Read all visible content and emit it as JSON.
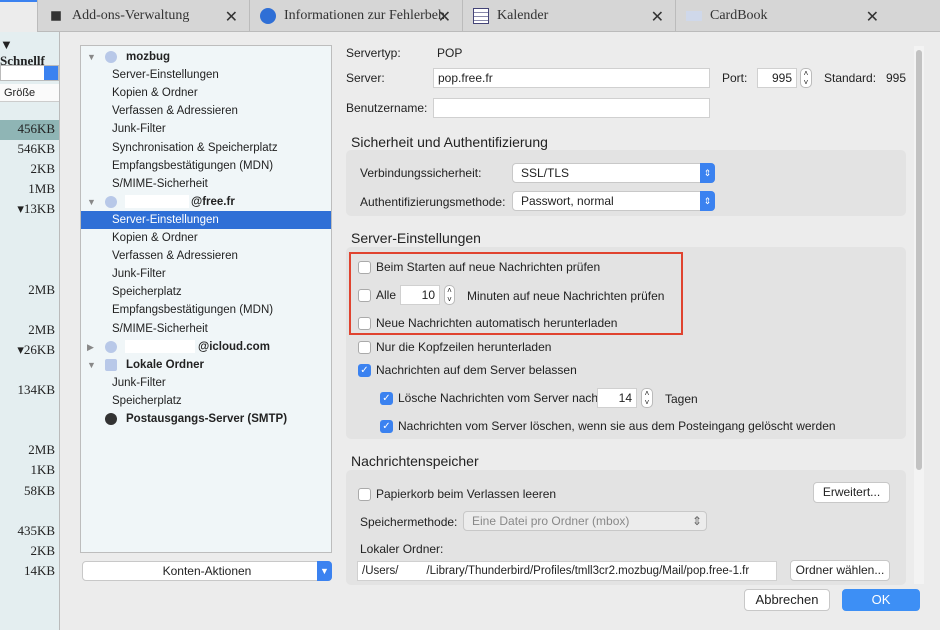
{
  "tabs": [
    {
      "label": "Add-ons-Verwaltung",
      "icon": "puzzle-icon"
    },
    {
      "label": "Informationen zur Fehlerbeh",
      "icon": "thunderbird-icon"
    },
    {
      "label": "Kalender",
      "icon": "calendar-icon"
    },
    {
      "label": "CardBook",
      "icon": "cardbook-icon"
    }
  ],
  "left": {
    "filter": "Schnellf",
    "col": "Größe",
    "sizes": [
      "456KB",
      "546KB",
      "2KB",
      "1MB",
      "▾13KB",
      "2MB",
      "2MB",
      "▾26KB",
      "134KB",
      "2MB",
      "1KB",
      "58KB",
      "435KB",
      "2KB",
      "14KB"
    ]
  },
  "tree": {
    "items": [
      {
        "label": "mozbug",
        "kind": "account"
      },
      {
        "label": "Server-Einstellungen"
      },
      {
        "label": "Kopien & Ordner"
      },
      {
        "label": "Verfassen & Adressieren"
      },
      {
        "label": "Junk-Filter"
      },
      {
        "label": "Synchronisation & Speicherplatz"
      },
      {
        "label": "Empfangsbestätigungen (MDN)"
      },
      {
        "label": "S/MIME-Sicherheit"
      },
      {
        "label": "@free.fr",
        "kind": "account"
      },
      {
        "label": "Server-Einstellungen",
        "selected": true
      },
      {
        "label": "Kopien & Ordner"
      },
      {
        "label": "Verfassen & Adressieren"
      },
      {
        "label": "Junk-Filter"
      },
      {
        "label": "Speicherplatz"
      },
      {
        "label": "Empfangsbestätigungen (MDN)"
      },
      {
        "label": "S/MIME-Sicherheit"
      },
      {
        "label": "@icloud.com",
        "kind": "account"
      },
      {
        "label": "Lokale Ordner",
        "kind": "local"
      },
      {
        "label": "Junk-Filter"
      },
      {
        "label": "Speicherplatz"
      },
      {
        "label": "Postausgangs-Server (SMTP)",
        "kind": "smtp"
      }
    ],
    "actions": "Konten-Aktionen"
  },
  "server": {
    "type_label": "Servertyp:",
    "type": "POP",
    "server_label": "Server:",
    "server": "pop.free.fr",
    "port_label": "Port:",
    "port": "995",
    "std_label": "Standard:",
    "std": "995",
    "user_label": "Benutzername:"
  },
  "security": {
    "title": "Sicherheit und Authentifizierung",
    "conn_label": "Verbindungssicherheit:",
    "conn": "SSL/TLS",
    "auth_label": "Authentifizierungsmethode:",
    "auth": "Passwort, normal"
  },
  "settings": {
    "title": "Server-Einstellungen",
    "check_start": "Beim Starten auf neue Nachrichten prüfen",
    "every": "Alle",
    "minutes": "10",
    "every_suffix": "Minuten auf neue Nachrichten prüfen",
    "auto_dl": "Neue Nachrichten automatisch herunterladen",
    "headers": "Nur die Kopfzeilen herunterladen",
    "leave": "Nachrichten auf dem Server belassen",
    "delete_after": "Lösche Nachrichten vom Server nach",
    "days": "14",
    "days_label": "Tagen",
    "delete_when": "Nachrichten vom Server löschen, wenn sie aus dem Posteingang gelöscht werden",
    "highlight_color": "#e0432f"
  },
  "storage": {
    "title": "Nachrichtenspeicher",
    "trash": "Papierkorb beim Verlassen leeren",
    "advanced": "Erweitert...",
    "method_label": "Speichermethode:",
    "method": "Eine Datei pro Ordner (mbox)",
    "folder_label": "Lokaler Ordner:",
    "path_a": "/Users/",
    "path_b": "/Library/Thunderbird/Profiles/tmll3cr2.mozbug/Mail/pop.free-1.fr",
    "choose": "Ordner wählen..."
  },
  "footer": {
    "cancel": "Abbrechen",
    "ok": "OK"
  }
}
